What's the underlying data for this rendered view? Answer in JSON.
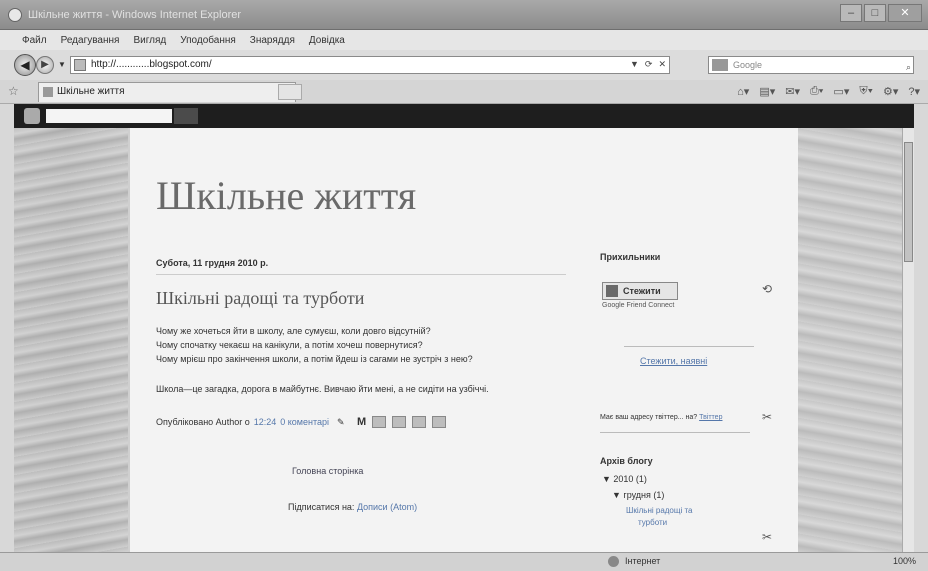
{
  "window": {
    "title": "Шкільне життя - Windows Internet Explorer"
  },
  "menu": {
    "items": [
      "Файл",
      "Редагування",
      "Вигляд",
      "Уподобання",
      "Знаряддя",
      "Довідка"
    ]
  },
  "address": {
    "url": "http://............blogspot.com/",
    "search_placeholder": "Google"
  },
  "tab": {
    "label": "Шкільне життя"
  },
  "blog": {
    "title": "Шкільне життя",
    "post_date": "Субота, 11 грудня 2010 р.",
    "post_title": "Шкільні радощі та турботи",
    "post_lines": [
      "Чому же хочеться йти в школу, але сумуєш, коли довго відсутній?",
      "Чому спочатку чекаєш   на   канікули, а потім хочеш повернутися?",
      "Чому мрієш про закінчення школи, а потім йдеш із сагами не зустріч з нею?",
      "Школа—це загадка, дорога в майбутнє. Вивчаю йти мені, а не сидіти на узбіччі."
    ],
    "posted_by": "Опубліковано Author о",
    "post_time": "12:24",
    "comments": "0 коментарі",
    "home_link": "Головна сторінка",
    "subscribe_label": "Підписатися на:",
    "subscribe_link": "Дописи (Atom)"
  },
  "sidebar": {
    "followers_heading": "Прихильники",
    "follow_button": "Стежити",
    "gfc_text": "Google Friend Connect",
    "existing_link": "Стежити, наявні",
    "twitter_question": "Має ваш адресу твіттер... на? ",
    "twitter_link": "Твіттер",
    "archive_heading": "Архів блогу",
    "archive_year": "▼ 2010 (1)",
    "archive_month": "▼ грудня (1)",
    "archive_post_1": "Шкільні радощі та",
    "archive_post_2": "турботи"
  },
  "status": {
    "zone": "Інтернет",
    "zoom": "100%"
  },
  "icons": {
    "ie": "ie-icon",
    "back": "back-arrow-icon",
    "forward": "forward-arrow-icon",
    "favorites": "star-icon",
    "edit": "edit-icon"
  }
}
